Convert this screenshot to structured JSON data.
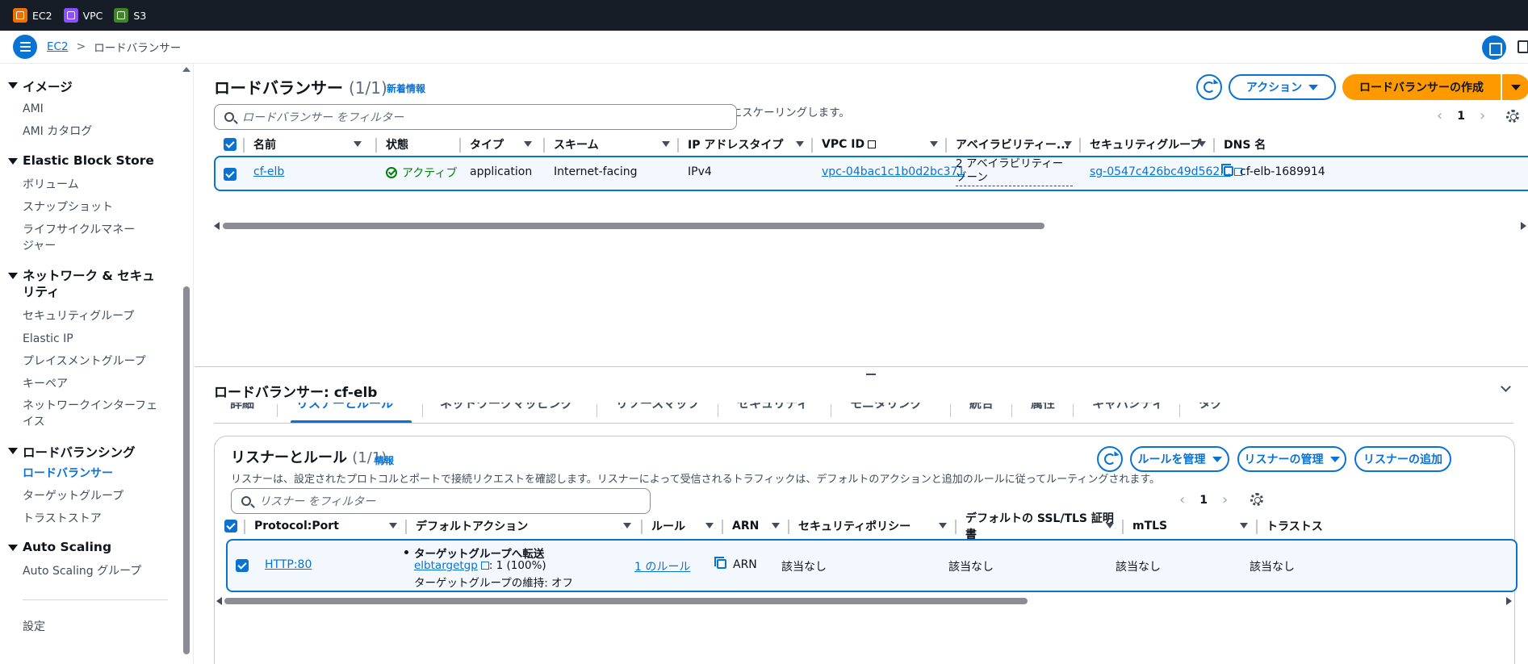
{
  "topbar": {
    "favorites": [
      {
        "label": "EC2",
        "icon": "ec2-icon",
        "color": "#ed7100"
      },
      {
        "label": "VPC",
        "icon": "vpc-icon",
        "color": "#8c4fff"
      },
      {
        "label": "S3",
        "icon": "s3-icon",
        "color": "#3f8624"
      }
    ]
  },
  "breadcrumb": {
    "root": "EC2",
    "separator": ">",
    "current": "ロードバランサー"
  },
  "sidebar": {
    "sections": [
      {
        "title": "イメージ",
        "items": [
          "AMI",
          "AMI カタログ"
        ]
      },
      {
        "title": "Elastic Block Store",
        "items": [
          "ボリューム",
          "スナップショット",
          "ライフサイクルマネージャー"
        ]
      },
      {
        "title": "ネットワーク & セキュリティ",
        "items": [
          "セキュリティグループ",
          "Elastic IP",
          "プレイスメントグループ",
          "キーペア",
          "ネットワークインターフェイス"
        ]
      },
      {
        "title": "ロードバランシング",
        "items": [
          "ロードバランサー",
          "ターゲットグループ",
          "トラストストア"
        ]
      },
      {
        "title": "Auto Scaling",
        "items": [
          "Auto Scaling グループ"
        ]
      }
    ],
    "active_item": "ロードバランサー",
    "settings": "設定"
  },
  "lb": {
    "title": "ロードバランサー",
    "count": "(1/1)",
    "info": "新着情報",
    "description": "Elastic Load Balancing は、着信トラフィックの変化に応じてロードバランサーキャパシティーを自動的にスケーリングします。",
    "actions_label": "アクション",
    "create_label": "ロードバランサーの作成",
    "filter_placeholder": "ロードバランサー をフィルター",
    "page": "1",
    "columns": [
      "名前",
      "状態",
      "タイプ",
      "スキーム",
      "IP アドレスタイプ",
      "VPC ID",
      "アベイラビリティー...",
      "セキュリティグループ",
      "DNS 名"
    ],
    "row": {
      "name": "cf-elb",
      "state": "アクティブ",
      "type": "application",
      "scheme": "Internet-facing",
      "ip_type": "IPv4",
      "vpc_id": "vpc-04bac1c1b0d2bc371",
      "az_line1": "2 アベイラビリティーゾーン",
      "az_line2": "ン",
      "security_group": "sg-0547c426bc49d562...",
      "dns": "cf-elb-1689914"
    }
  },
  "detail": {
    "title": "ロードバランサー: cf-elb",
    "tabs": [
      "詳細",
      "リスナーとルール",
      "ネットワークマッピング",
      "リソースマップ",
      "セキュリティ",
      "モニタリング",
      "統合",
      "属性",
      "キャパシティ",
      "タグ"
    ],
    "active_tab": "リスナーとルール"
  },
  "listeners": {
    "title": "リスナーとルール",
    "count": "(1/1)",
    "info": "情報",
    "description": "リスナーは、設定されたプロトコルとポートで接続リクエストを確認します。リスナーによって受信されるトラフィックは、デフォルトのアクションと追加のルールに従ってルーティングされます。",
    "manage_rules": "ルールを管理",
    "manage_listeners": "リスナーの管理",
    "add_listener": "リスナーの追加",
    "filter_placeholder": "リスナー をフィルター",
    "page": "1",
    "columns": [
      "Protocol:Port",
      "デフォルトアクション",
      "ルール",
      "ARN",
      "セキュリティポリシー",
      "デフォルトの SSL/TLS 証明書",
      "mTLS",
      "トラストス"
    ],
    "row": {
      "protocol_port": "HTTP:80",
      "action_title": "ターゲットグループへ転送",
      "target_group": "elbtargetgp",
      "weight": ": 1 (100%)",
      "stickiness": "ターゲットグループの維持: オフ",
      "rules": "1 のルール",
      "arn": "ARN",
      "security_policy": "該当なし",
      "ssl_cert": "該当なし",
      "mtls": "該当なし",
      "trust": "該当なし"
    }
  }
}
